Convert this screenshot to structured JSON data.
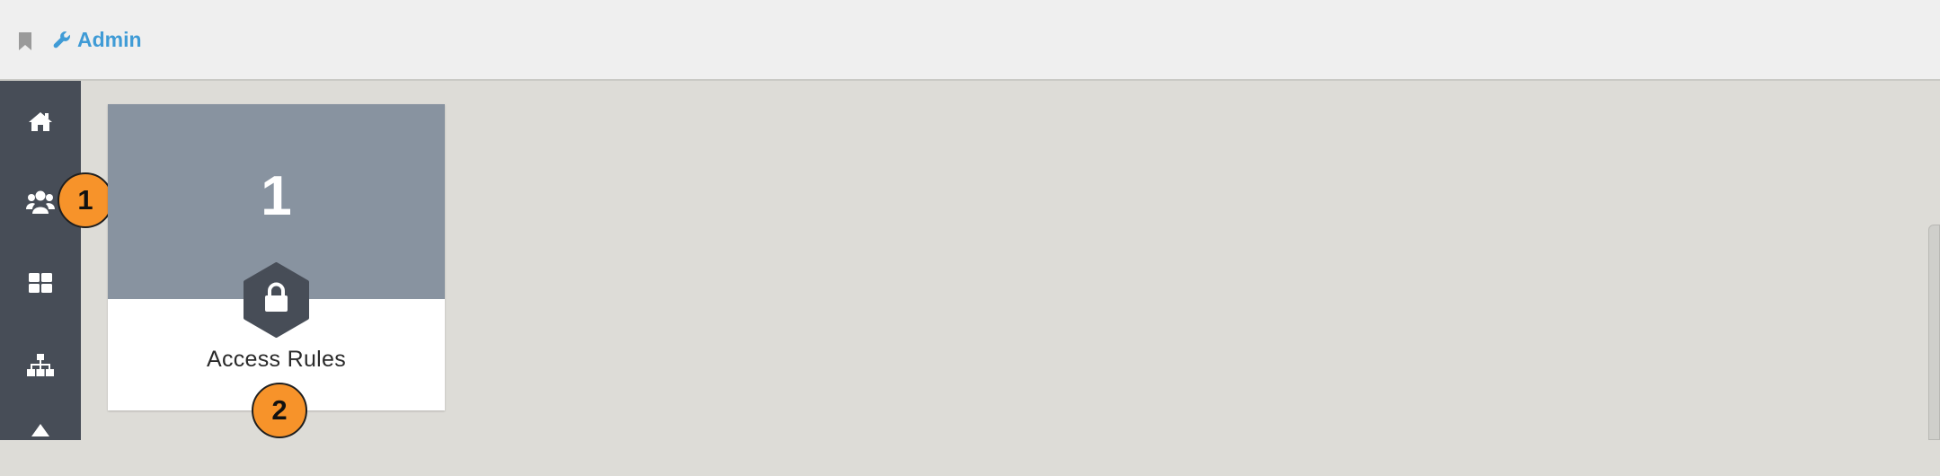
{
  "header": {
    "bookmark_icon": "bookmark-icon",
    "breadcrumb": {
      "icon": "wrench-icon",
      "label": "Admin"
    }
  },
  "sidebar": {
    "items": [
      {
        "icon": "home-icon"
      },
      {
        "icon": "users-icon"
      },
      {
        "icon": "grid-icon"
      },
      {
        "icon": "sitemap-icon"
      },
      {
        "icon": "up-arrow-icon"
      }
    ]
  },
  "badges": [
    "1",
    "2"
  ],
  "tiles": [
    {
      "count": "1",
      "label": "Access Rules",
      "icon": "lock-icon"
    }
  ],
  "colors": {
    "accent": "#3f9bd6",
    "badge": "#f7932a",
    "sidebar": "#474d57",
    "tile_top": "#8893a0",
    "background": "#dddcd7"
  }
}
